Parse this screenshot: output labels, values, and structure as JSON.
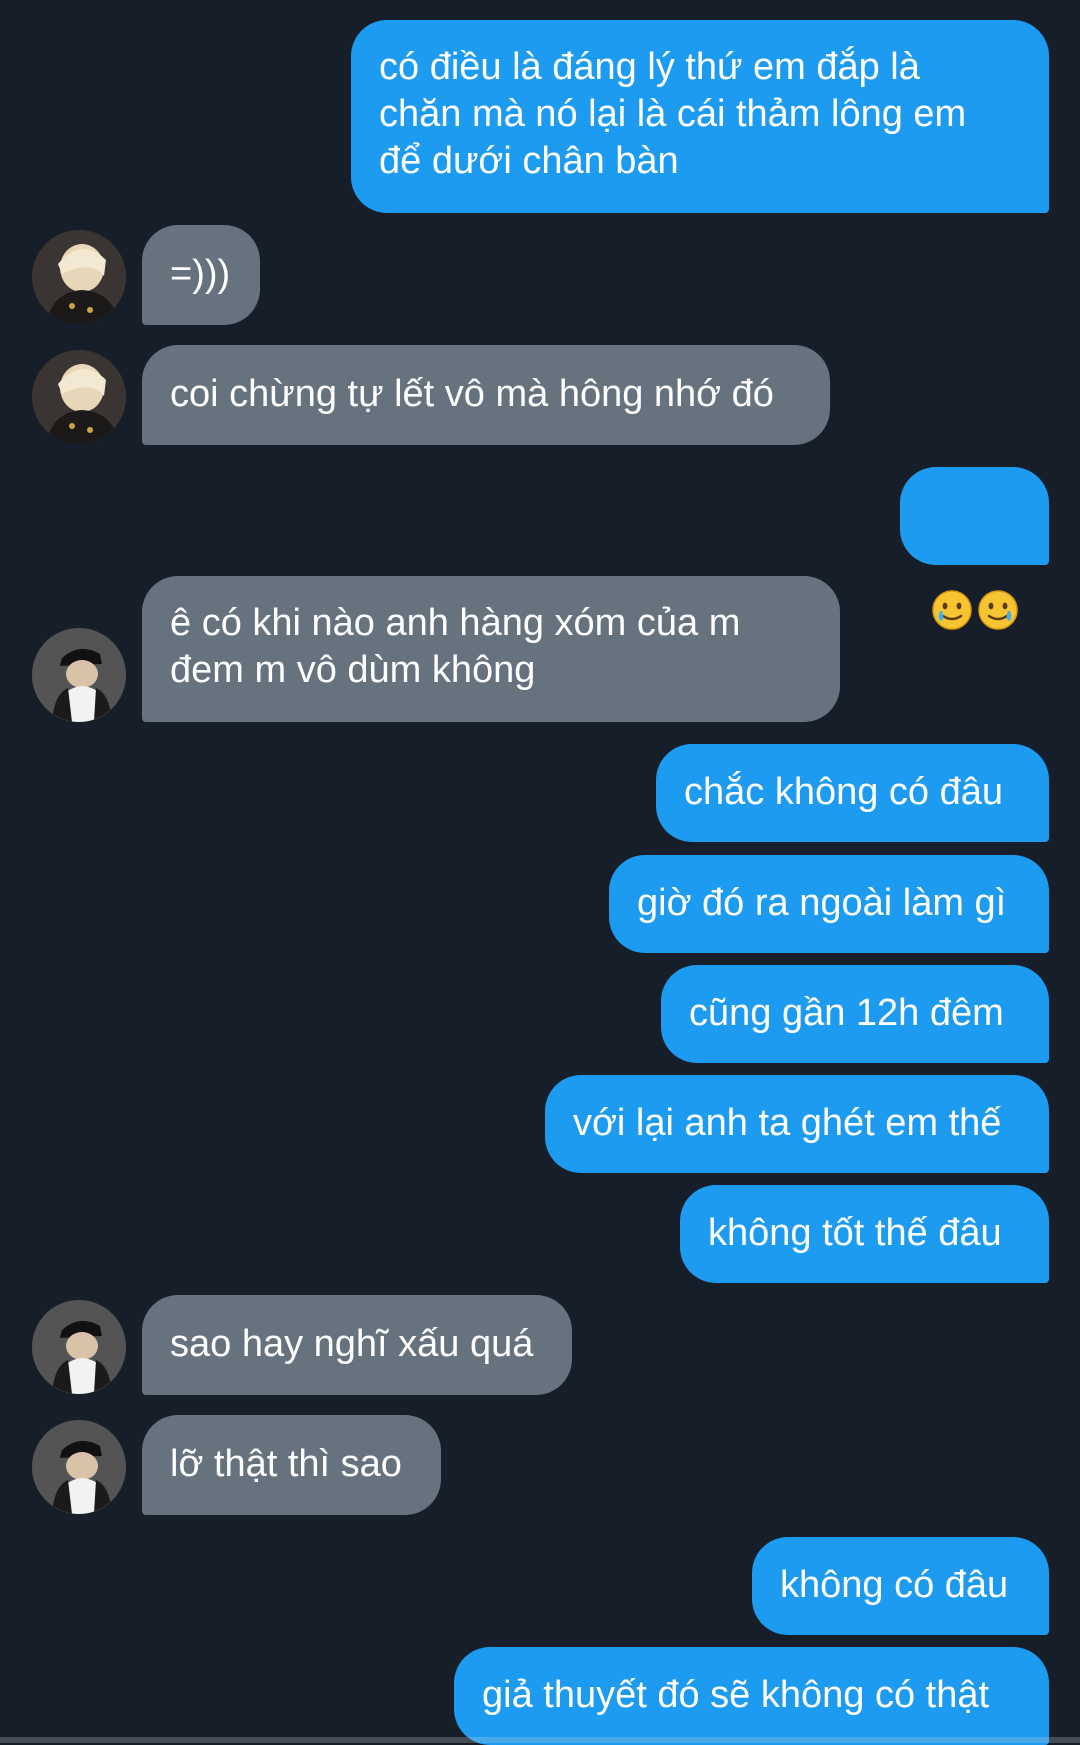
{
  "colors": {
    "background": "#161f29",
    "outgoing_bubble": "#1d9bf0",
    "incoming_bubble": "#66737f",
    "text": "#ffffff"
  },
  "messages": [
    {
      "side": "out",
      "text": "có điều là đáng lý thứ em đắp là\nchăn mà nó lại là cái thảm lông em\nđể dưới chân bàn"
    },
    {
      "side": "in",
      "avatar": "avatar-blonde",
      "text": "=)))"
    },
    {
      "side": "in",
      "avatar": "avatar-blonde",
      "text": "coi chừng tự lết vô mà hông nhớ đó"
    },
    {
      "side": "out",
      "emoji": [
        "smiling-face-with-tear-icon",
        "smiling-face-with-tear-icon"
      ]
    },
    {
      "side": "in",
      "avatar": "avatar-cap",
      "text": "ê có khi nào anh hàng xóm của m\nđem m vô dùm không"
    },
    {
      "side": "out",
      "text": "chắc không có đâu"
    },
    {
      "side": "out",
      "text": "giờ đó ra ngoài làm gì"
    },
    {
      "side": "out",
      "text": "cũng gần 12h đêm"
    },
    {
      "side": "out",
      "text": "với lại anh ta ghét em thế"
    },
    {
      "side": "out",
      "text": "không tốt thế đâu"
    },
    {
      "side": "in",
      "avatar": "avatar-cap",
      "text": "sao hay nghĩ xấu quá"
    },
    {
      "side": "in",
      "avatar": "avatar-cap",
      "text": "lỡ thật thì sao"
    },
    {
      "side": "out",
      "text": "không có đâu"
    },
    {
      "side": "out",
      "text": "giả thuyết đó sẽ không có thật"
    }
  ]
}
